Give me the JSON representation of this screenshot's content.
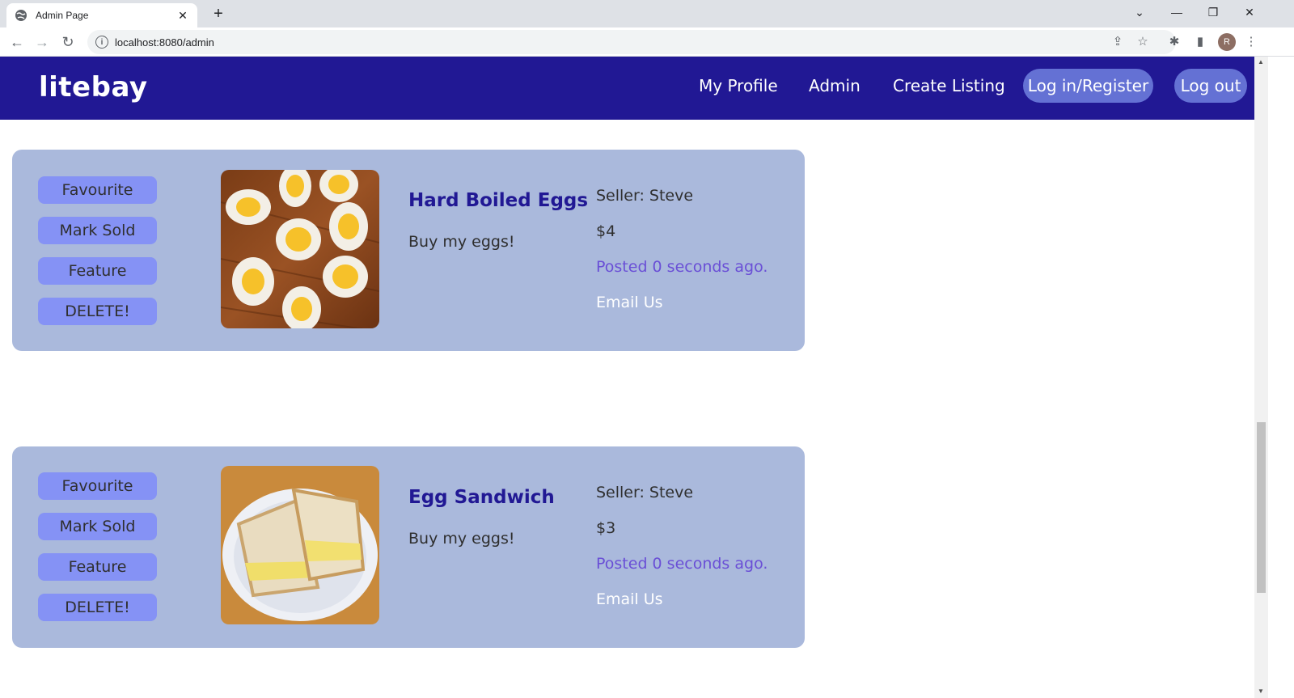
{
  "browser": {
    "tab_title": "Admin Page",
    "url": "localhost:8080/admin",
    "profile_initial": "R"
  },
  "navbar": {
    "brand": "litebay",
    "links": [
      "My Profile",
      "Admin",
      "Create Listing"
    ],
    "login_label": "Log in/Register",
    "logout_label": "Log out"
  },
  "listings": [
    {
      "buttons": [
        "Favourite",
        "Mark Sold",
        "Feature",
        "DELETE!"
      ],
      "image": "boiled-eggs-photo",
      "title": "Hard Boiled Eggs",
      "description": "Buy my eggs!",
      "seller": "Seller: Steve",
      "price": "$4",
      "posted": "Posted 0 seconds ago.",
      "email": "Email Us"
    },
    {
      "buttons": [
        "Favourite",
        "Mark Sold",
        "Feature",
        "DELETE!"
      ],
      "image": "egg-sandwich-photo",
      "title": "Egg Sandwich",
      "description": "Buy my eggs!",
      "seller": "Seller: Steve",
      "price": "$3",
      "posted": "Posted 0 seconds ago.",
      "email": "Email Us"
    }
  ],
  "colors": {
    "navbar": "#211894",
    "card": "#aab9dc",
    "button": "#8592f5",
    "title": "#211894",
    "posted": "#6a4fd6"
  }
}
